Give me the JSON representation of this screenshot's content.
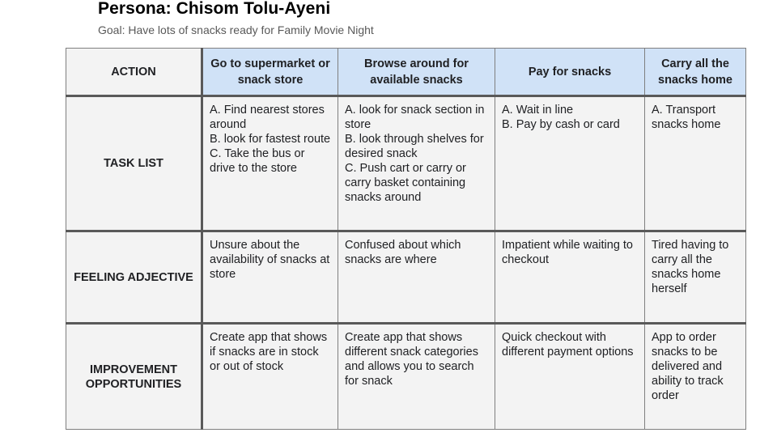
{
  "header": {
    "title": "Persona: Chisom Tolu-Ayeni",
    "subtitle": "Goal: Have lots of snacks ready for Family Movie Night"
  },
  "colors": {
    "stage_header_bg": "#d0e2f7",
    "cell_bg": "#f3f3f3"
  },
  "journey_map": {
    "corner_label": "ACTION",
    "stages": [
      "Go to supermarket or snack store",
      "Browse around for available snacks",
      "Pay for snacks",
      "Carry all the snacks home"
    ],
    "rows": [
      {
        "label": "TASK LIST",
        "cells": [
          [
            "A. Find nearest stores around",
            "B. look for fastest route",
            "C. Take the bus or drive to the store"
          ],
          [
            "A. look for snack section in store",
            "B. look through shelves for desired snack",
            "C. Push cart or carry or carry basket containing snacks around"
          ],
          [
            "A. Wait in line",
            "B. Pay by cash or card"
          ],
          [
            "A. Transport snacks home"
          ]
        ]
      },
      {
        "label": "FEELING ADJECTIVE",
        "cells": [
          [
            "Unsure about the availability of snacks at store"
          ],
          [
            "Confused about which snacks are where"
          ],
          [
            "Impatient while waiting to checkout"
          ],
          [
            "Tired having to carry all the snacks home herself"
          ]
        ]
      },
      {
        "label": "IMPROVEMENT OPPORTUNITIES",
        "cells": [
          [
            "Create app that shows if snacks are in stock or out of stock"
          ],
          [
            "Create app that shows different snack categories and allows you to search for snack"
          ],
          [
            "Quick checkout with different payment options"
          ],
          [
            "App to order snacks to be delivered and ability to track order"
          ]
        ]
      }
    ]
  }
}
